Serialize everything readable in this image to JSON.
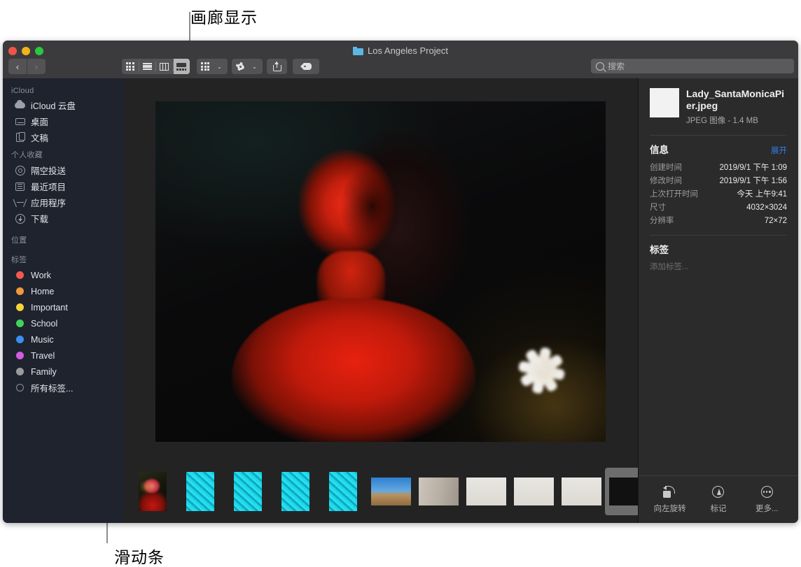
{
  "annotations": {
    "top": "画廊显示",
    "bottom": "滑动条"
  },
  "window": {
    "title": "Los Angeles Project",
    "folder_icon": "folder-icon",
    "traffic": {
      "close": "close-button",
      "minimize": "minimize-button",
      "zoom": "zoom-button"
    }
  },
  "toolbar": {
    "back_label": "‹",
    "forward_label": "›",
    "views": [
      {
        "name": "icon-view",
        "icon": "grid-icon",
        "active": false
      },
      {
        "name": "list-view",
        "icon": "list-icon",
        "active": false
      },
      {
        "name": "column-view",
        "icon": "columns-icon",
        "active": false
      },
      {
        "name": "gallery-view",
        "icon": "gallery-icon",
        "active": true
      }
    ],
    "group_button_icon": "grid-small-icon",
    "action_button_icon": "gear-icon",
    "share_button_icon": "share-icon",
    "tag_button_icon": "tag-icon",
    "caret": "⌄"
  },
  "search": {
    "placeholder": "搜索",
    "value": "",
    "icon": "search-icon"
  },
  "sidebar": {
    "sections": [
      {
        "title": "iCloud",
        "items": [
          {
            "label": "iCloud 云盘",
            "icon": "cloud-icon"
          },
          {
            "label": "桌面",
            "icon": "desktop-icon"
          },
          {
            "label": "文稿",
            "icon": "documents-icon"
          }
        ]
      },
      {
        "title": "个人收藏",
        "items": [
          {
            "label": "隔空投送",
            "icon": "airdrop-icon"
          },
          {
            "label": "最近项目",
            "icon": "recents-icon"
          },
          {
            "label": "应用程序",
            "icon": "applications-icon"
          },
          {
            "label": "下载",
            "icon": "downloads-icon"
          }
        ]
      },
      {
        "title": "位置",
        "items": []
      },
      {
        "title": "标签",
        "items": [
          {
            "label": "Work",
            "icon": "tag-dot",
            "color": "#f4584f"
          },
          {
            "label": "Home",
            "icon": "tag-dot",
            "color": "#f0983a"
          },
          {
            "label": "Important",
            "icon": "tag-dot",
            "color": "#f5d23b"
          },
          {
            "label": "School",
            "icon": "tag-dot",
            "color": "#3fd35a"
          },
          {
            "label": "Music",
            "icon": "tag-dot",
            "color": "#3b8ff0"
          },
          {
            "label": "Travel",
            "icon": "tag-dot",
            "color": "#d25ce0"
          },
          {
            "label": "Family",
            "icon": "tag-dot",
            "color": "#9b9b9b"
          },
          {
            "label": "所有标签...",
            "icon": "tag-ring",
            "color": ""
          }
        ]
      }
    ]
  },
  "preview": {
    "name": "hero-photo-red-portrait"
  },
  "filmstrip": {
    "items": [
      {
        "name": "thumb-1",
        "art": "t-red-fg",
        "shape": "portrait",
        "selected": false
      },
      {
        "name": "thumb-2",
        "art": "t-pool",
        "shape": "portrait",
        "selected": false
      },
      {
        "name": "thumb-3",
        "art": "t-pool",
        "shape": "portrait",
        "selected": false
      },
      {
        "name": "thumb-4",
        "art": "t-pool",
        "shape": "portrait",
        "selected": false
      },
      {
        "name": "thumb-5",
        "art": "t-pool",
        "shape": "portrait",
        "selected": false
      },
      {
        "name": "thumb-6",
        "art": "t-sky",
        "shape": "land",
        "selected": false
      },
      {
        "name": "thumb-7",
        "art": "t-wall",
        "shape": "land",
        "selected": false
      },
      {
        "name": "thumb-8",
        "art": "t-plant",
        "shape": "land",
        "selected": false
      },
      {
        "name": "thumb-9",
        "art": "t-plant",
        "shape": "land",
        "selected": false
      },
      {
        "name": "thumb-10",
        "art": "t-plant",
        "shape": "land",
        "selected": false
      },
      {
        "name": "thumb-11",
        "art": "t-darkred",
        "shape": "land",
        "selected": true
      }
    ]
  },
  "info": {
    "file_name": "Lady_SantaMonicaPier.jpeg",
    "file_kind": "JPEG 图像 - 1.4 MB",
    "info_title": "信息",
    "expand_label": "展开",
    "rows": [
      {
        "key": "创建时间",
        "value": "2019/9/1 下午 1:09"
      },
      {
        "key": "修改时间",
        "value": "2019/9/1 下午 1:56"
      },
      {
        "key": "上次打开时间",
        "value": "今天 上午9:41"
      },
      {
        "key": "尺寸",
        "value": "4032×3024"
      },
      {
        "key": "分辨率",
        "value": "72×72"
      }
    ],
    "tags_title": "标签",
    "tags_placeholder": "添加标签...",
    "actions": [
      {
        "label": "向左旋转",
        "icon": "rotate-left-icon"
      },
      {
        "label": "标记",
        "icon": "markup-icon"
      },
      {
        "label": "更多...",
        "icon": "more-icon"
      }
    ]
  },
  "colors": {
    "accent_link": "#2f7fe8",
    "sidebar_bg": "#1e232e",
    "content_bg": "#232323",
    "panel_bg": "#2b2b2b",
    "titlebar_bg": "#3b3b3d"
  }
}
